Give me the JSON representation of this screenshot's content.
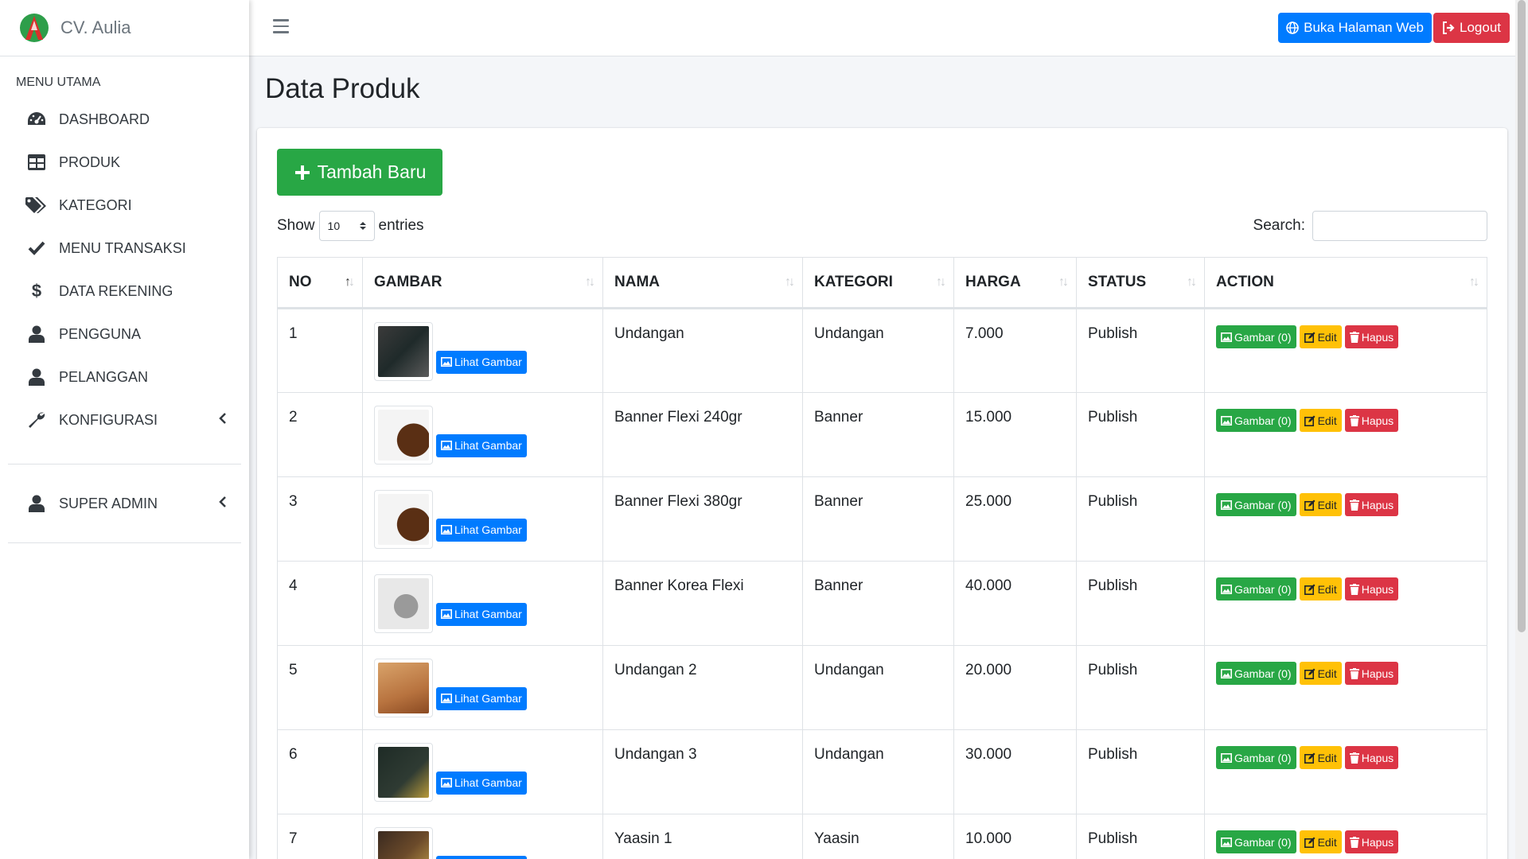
{
  "brand": {
    "name": "CV. Aulia"
  },
  "sidebar": {
    "header": "MENU UTAMA",
    "items": [
      {
        "label": "DASHBOARD",
        "icon": "tachometer-icon"
      },
      {
        "label": "PRODUK",
        "icon": "table-icon"
      },
      {
        "label": "KATEGORI",
        "icon": "tags-icon"
      },
      {
        "label": "MENU TRANSAKSI",
        "icon": "check-icon"
      },
      {
        "label": "DATA REKENING",
        "icon": "dollar-icon"
      },
      {
        "label": "PENGGUNA",
        "icon": "user-icon"
      },
      {
        "label": "PELANGGAN",
        "icon": "user-icon"
      },
      {
        "label": "KONFIGURASI",
        "icon": "wrench-icon"
      }
    ],
    "admin": {
      "label": "SUPER ADMIN",
      "icon": "user-icon"
    }
  },
  "topbar": {
    "web_button": "Buka Halaman Web",
    "logout_button": "Logout"
  },
  "page": {
    "title": "Data Produk"
  },
  "toolbar": {
    "add_button": "Tambah Baru",
    "show_label": "Show",
    "entries_value": "10",
    "entries_label": "entries",
    "search_label": "Search:"
  },
  "table": {
    "columns": [
      "NO",
      "GAMBAR",
      "NAMA",
      "KATEGORI",
      "HARGA",
      "STATUS",
      "ACTION"
    ],
    "view_image_label": "Lihat Gambar",
    "action_labels": {
      "gambar": "Gambar (0)",
      "edit": "Edit",
      "hapus": "Hapus"
    },
    "rows": [
      {
        "no": "1",
        "nama": "Undangan",
        "kategori": "Undangan",
        "harga": "7.000",
        "status": "Publish"
      },
      {
        "no": "2",
        "nama": "Banner Flexi 240gr",
        "kategori": "Banner",
        "harga": "15.000",
        "status": "Publish"
      },
      {
        "no": "3",
        "nama": "Banner Flexi 380gr",
        "kategori": "Banner",
        "harga": "25.000",
        "status": "Publish"
      },
      {
        "no": "4",
        "nama": "Banner Korea Flexi",
        "kategori": "Banner",
        "harga": "40.000",
        "status": "Publish"
      },
      {
        "no": "5",
        "nama": "Undangan 2",
        "kategori": "Undangan",
        "harga": "20.000",
        "status": "Publish"
      },
      {
        "no": "6",
        "nama": "Undangan 3",
        "kategori": "Undangan",
        "harga": "30.000",
        "status": "Publish"
      },
      {
        "no": "7",
        "nama": "Yaasin 1",
        "kategori": "Yaasin",
        "harga": "10.000",
        "status": "Publish"
      }
    ]
  },
  "colors": {
    "primary": "#007bff",
    "success": "#28a745",
    "warning": "#ffc107",
    "danger": "#dc3545"
  }
}
